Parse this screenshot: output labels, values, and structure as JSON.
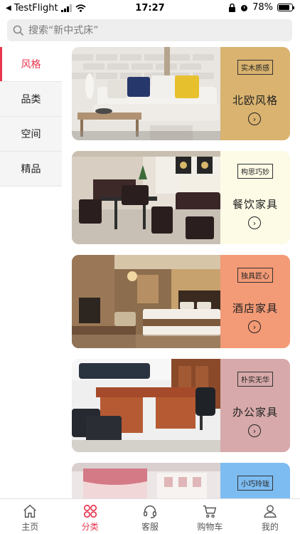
{
  "status_bar": {
    "carrier": "TestFlight",
    "time": "17:27",
    "battery": "78%"
  },
  "search": {
    "placeholder": "搜索“新中式床”"
  },
  "sidebar": {
    "items": [
      {
        "label": "风格",
        "active": true
      },
      {
        "label": "品类",
        "active": false
      },
      {
        "label": "空间",
        "active": false
      },
      {
        "label": "精品",
        "active": false
      }
    ]
  },
  "cards": [
    {
      "tag": "实木质感",
      "title": "北欧风格",
      "panel_color": "#d9b36f"
    },
    {
      "tag": "构思巧妙",
      "title": "餐饮家具",
      "panel_color": "#fdfbe6"
    },
    {
      "tag": "独具匠心",
      "title": "酒店家具",
      "panel_color": "#f39a76"
    },
    {
      "tag": "朴实无华",
      "title": "办公家具",
      "panel_color": "#d7a9aa"
    },
    {
      "tag": "小巧玲珑",
      "panel_color": "#7dbcf1"
    }
  ],
  "tabbar": {
    "items": [
      {
        "label": "主页",
        "icon": "home-icon"
      },
      {
        "label": "分类",
        "icon": "category-icon",
        "active": true
      },
      {
        "label": "客服",
        "icon": "headset-icon"
      },
      {
        "label": "购物车",
        "icon": "cart-icon"
      },
      {
        "label": "我的",
        "icon": "user-icon"
      }
    ]
  }
}
